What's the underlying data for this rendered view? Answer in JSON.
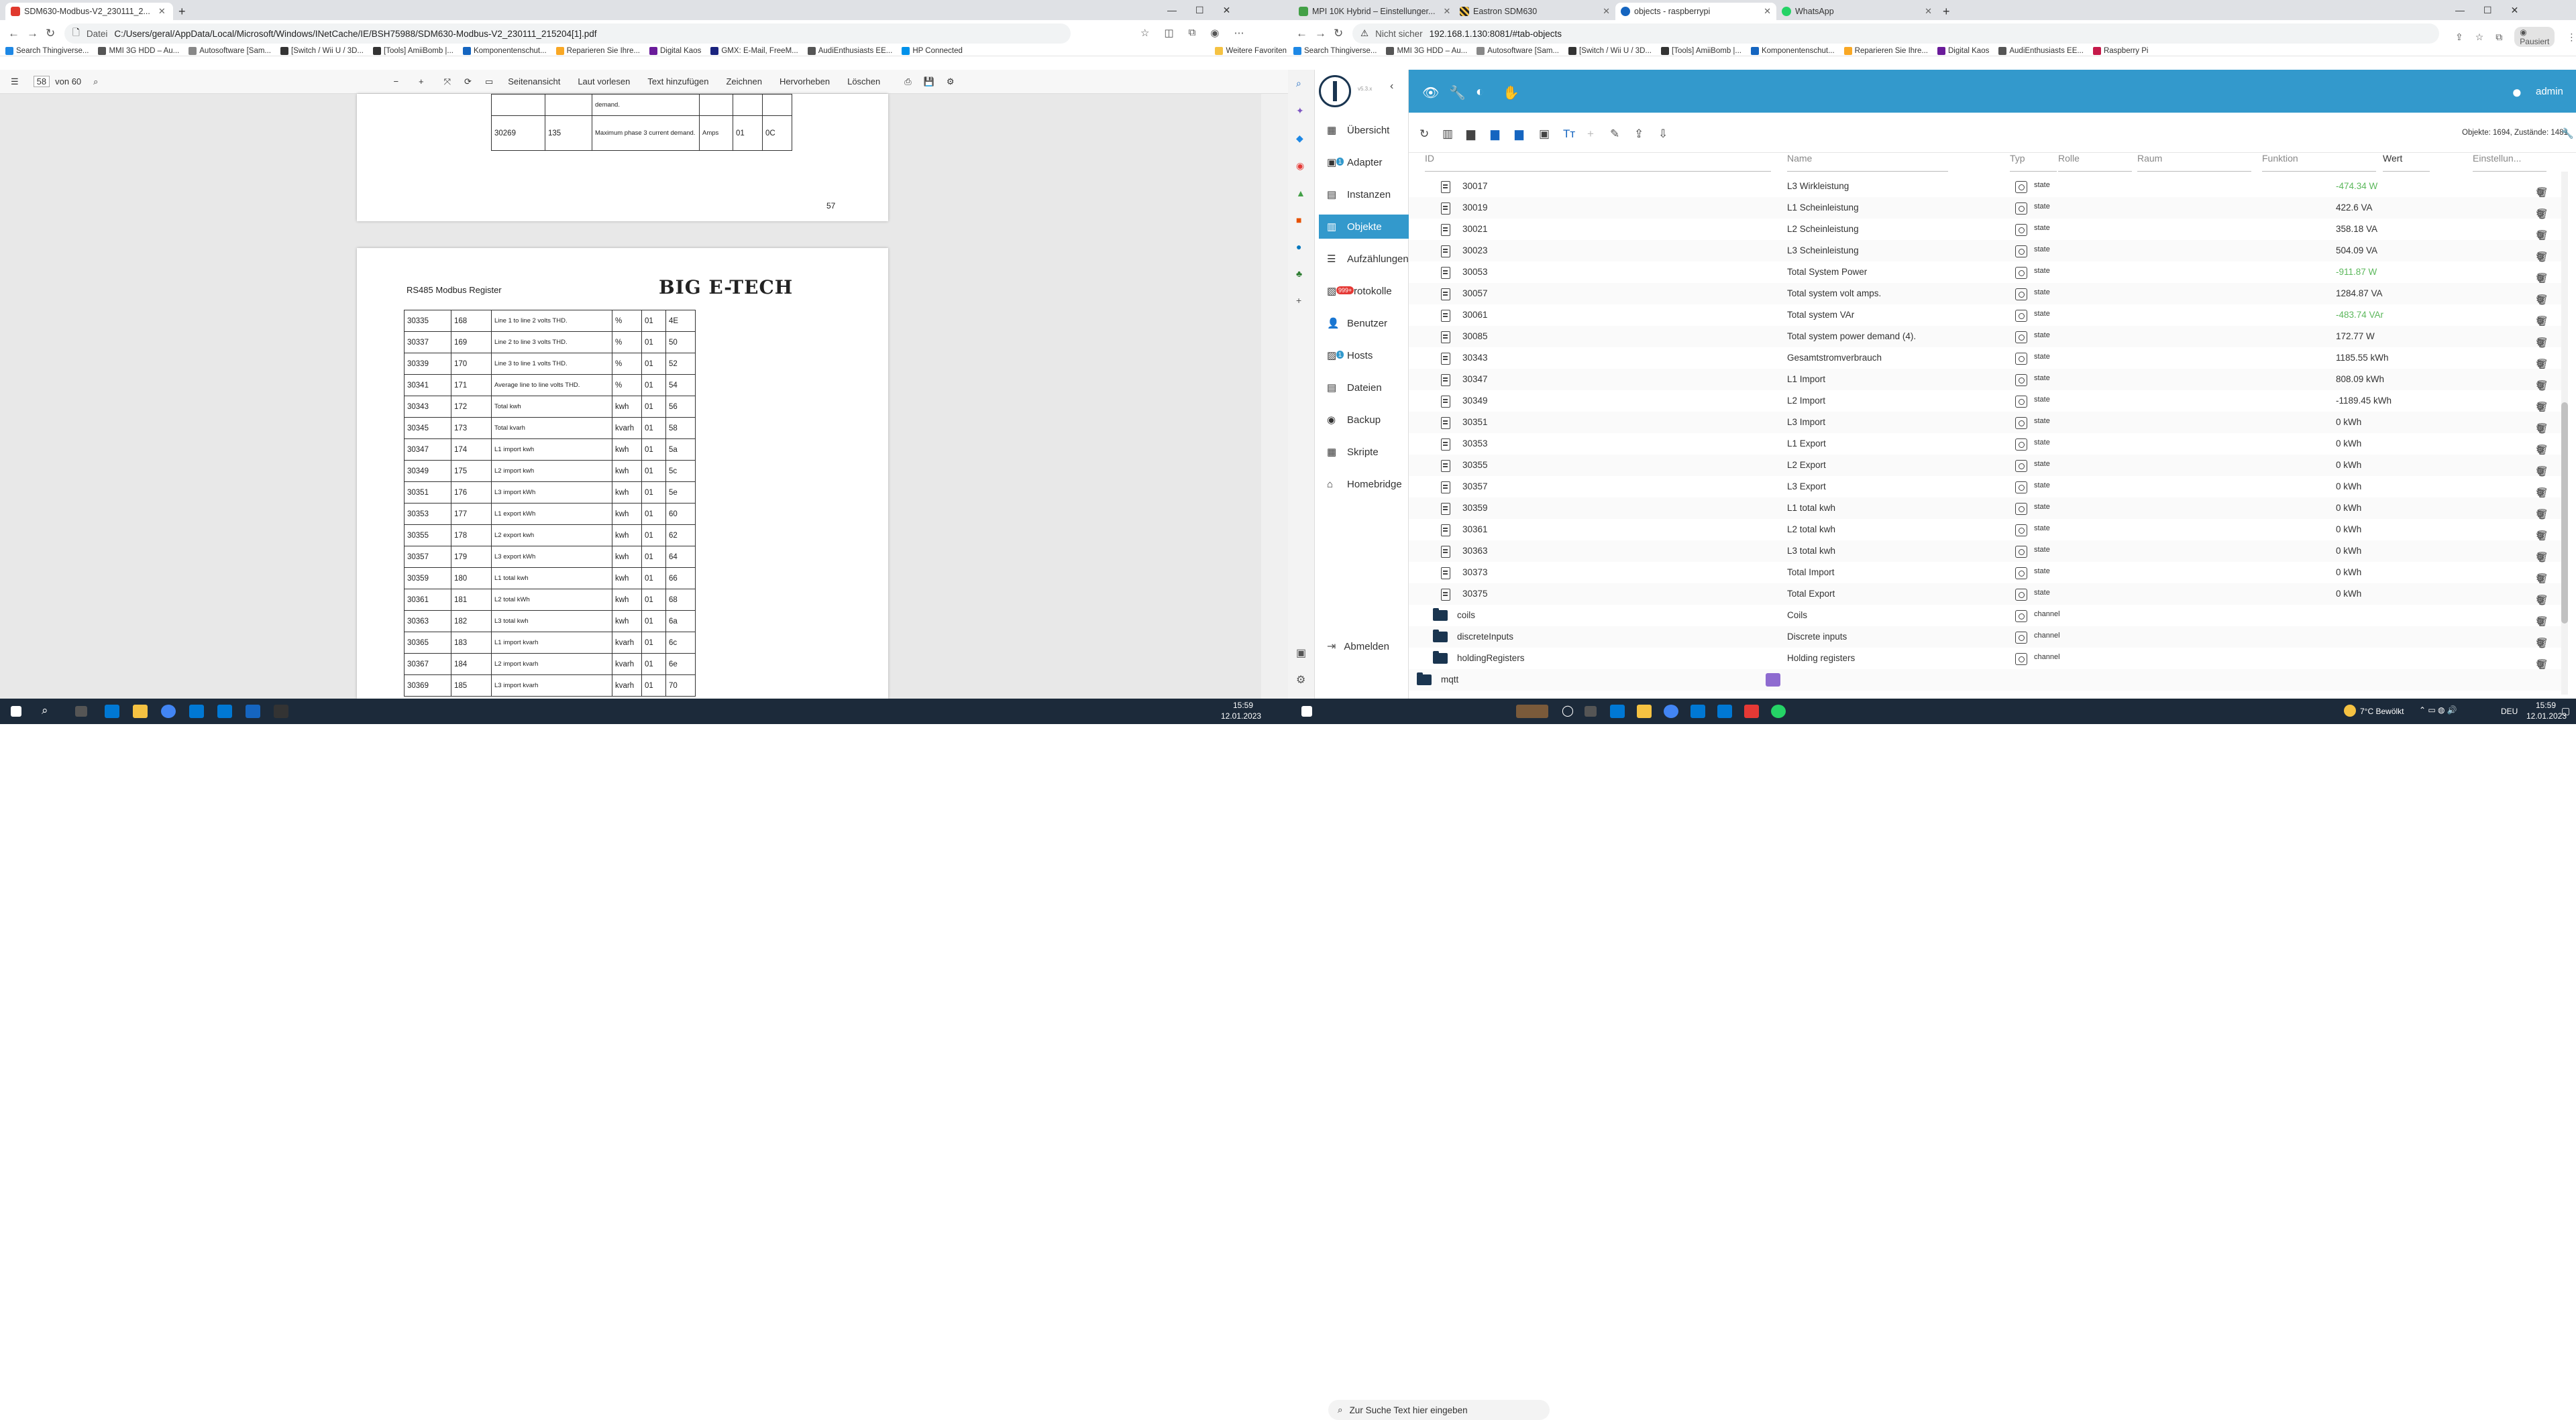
{
  "left_browser": {
    "tabs": [
      {
        "label": "SDM630-Modbus-V2_230111_2..."
      }
    ],
    "address": {
      "label": "Datei",
      "url": "C:/Users/geral/AppData/Local/Microsoft/Windows/INetCache/IE/BSH75988/SDM630-Modbus-V2_230111_215204[1].pdf"
    },
    "bookmarks": [
      "Search Thingiverse...",
      "MMI 3G HDD – Au...",
      "Autosoftware [Sam...",
      "[Switch / Wii U / 3D...",
      "[Tools] AmiiBomb |...",
      "Komponentenschut...",
      "Reparieren Sie Ihre...",
      "Digital Kaos",
      "GMX: E-Mail, FreeM...",
      "AudiEnthusiasts EE...",
      "HP Connected",
      "Weitere Favoriten"
    ],
    "pdf_toolbar": {
      "page_value": "58",
      "page_of": "von 60",
      "items": [
        "Seitenansicht",
        "Laut vorlesen",
        "Text hinzufügen",
        "Zeichnen",
        "Hervorheben",
        "Löschen"
      ]
    },
    "page1": {
      "rows": [
        [
          "",
          "",
          "demand.",
          "",
          "",
          ""
        ],
        [
          "30269",
          "135",
          "Maximum phase 3 current demand.",
          "Amps",
          "01",
          "0C"
        ]
      ],
      "page_number": "57"
    },
    "page2": {
      "heading": "RS485 Modbus Register",
      "logo": "BIG E-TECH",
      "rows": [
        [
          "30335",
          "168",
          "Line 1 to line 2 volts THD.",
          "%",
          "01",
          "4E"
        ],
        [
          "30337",
          "169",
          "Line 2 to line 3 volts THD.",
          "%",
          "01",
          "50"
        ],
        [
          "30339",
          "170",
          "Line 3 to line 1 volts THD.",
          "%",
          "01",
          "52"
        ],
        [
          "30341",
          "171",
          "Average line to line volts THD.",
          "%",
          "01",
          "54"
        ],
        [
          "30343",
          "172",
          "Total kwh",
          "kwh",
          "01",
          "56"
        ],
        [
          "30345",
          "173",
          "Total kvarh",
          "kvarh",
          "01",
          "58"
        ],
        [
          "30347",
          "174",
          "L1 import kwh",
          "kwh",
          "01",
          "5a"
        ],
        [
          "30349",
          "175",
          "L2 import kwh",
          "kwh",
          "01",
          "5c"
        ],
        [
          "30351",
          "176",
          "L3 import kWh",
          "kwh",
          "01",
          "5e"
        ],
        [
          "30353",
          "177",
          "L1 export kWh",
          "kwh",
          "01",
          "60"
        ],
        [
          "30355",
          "178",
          "L2 export kwh",
          "kwh",
          "01",
          "62"
        ],
        [
          "30357",
          "179",
          "L3 export kWh",
          "kwh",
          "01",
          "64"
        ],
        [
          "30359",
          "180",
          "L1 total kwh",
          "kwh",
          "01",
          "66"
        ],
        [
          "30361",
          "181",
          "L2 total kWh",
          "kwh",
          "01",
          "68"
        ],
        [
          "30363",
          "182",
          "L3 total kwh",
          "kwh",
          "01",
          "6a"
        ],
        [
          "30365",
          "183",
          "L1 import kvarh",
          "kvarh",
          "01",
          "6c"
        ],
        [
          "30367",
          "184",
          "L2 import kvarh",
          "kvarh",
          "01",
          "6e"
        ],
        [
          "30369",
          "185",
          "L3 import kvarh",
          "kvarh",
          "01",
          "70"
        ]
      ]
    }
  },
  "right_browser": {
    "tabs": [
      {
        "label": "MPI 10K Hybrid – Einstellunger..."
      },
      {
        "label": "Eastron SDM630"
      },
      {
        "label": "objects - raspberrypi"
      },
      {
        "label": "WhatsApp"
      }
    ],
    "address": {
      "label": "Nicht sicher",
      "url": "192.168.1.130:8081/#tab-objects"
    },
    "bookmarks": [
      "Search Thingiverse...",
      "MMI 3G HDD – Au...",
      "Autosoftware [Sam...",
      "[Switch / Wii U / 3D...",
      "[Tools] AmiiBomb |...",
      "Komponentenschut...",
      "Reparieren Sie Ihre...",
      "Digital Kaos",
      "AudiEnthusiasts EE...",
      "Raspberry Pi"
    ],
    "user": "admin",
    "menu": [
      {
        "label": "Übersicht",
        "badge": ""
      },
      {
        "label": "Adapter",
        "badge": "1"
      },
      {
        "label": "Instanzen",
        "badge": ""
      },
      {
        "label": "Objekte",
        "badge": ""
      },
      {
        "label": "Aufzählungen",
        "badge": ""
      },
      {
        "label": "Protokolle",
        "badge": "999+"
      },
      {
        "label": "Benutzer",
        "badge": ""
      },
      {
        "label": "Hosts",
        "badge": "1"
      },
      {
        "label": "Dateien",
        "badge": ""
      },
      {
        "label": "Backup",
        "badge": ""
      },
      {
        "label": "Skripte",
        "badge": ""
      },
      {
        "label": "Homebridge",
        "badge": ""
      }
    ],
    "logout": "Abmelden",
    "version": "v5.3.x",
    "objects_count": "Objekte: 1694, Zustände: 1481",
    "columns": {
      "id": "ID",
      "name": "Name",
      "type": "Typ",
      "role": "Rolle",
      "room": "Raum",
      "function": "Funktion",
      "value": "Wert",
      "settings": "Einstellun..."
    },
    "rows": [
      {
        "id": "30017",
        "name": "L3 Wirkleistung",
        "type": "state",
        "value": "-474.34 W",
        "color": "#5cb85c"
      },
      {
        "id": "30019",
        "name": "L1 Scheinleistung",
        "type": "state",
        "value": "422.6 VA",
        "color": "#333333"
      },
      {
        "id": "30021",
        "name": "L2 Scheinleistung",
        "type": "state",
        "value": "358.18 VA",
        "color": "#333333"
      },
      {
        "id": "30023",
        "name": "L3 Scheinleistung",
        "type": "state",
        "value": "504.09 VA",
        "color": "#333333"
      },
      {
        "id": "30053",
        "name": "Total System Power",
        "type": "state",
        "value": "-911.87 W",
        "color": "#5cb85c"
      },
      {
        "id": "30057",
        "name": "Total system volt amps.",
        "type": "state",
        "value": "1284.87 VA",
        "color": "#333333"
      },
      {
        "id": "30061",
        "name": "Total system VAr",
        "type": "state",
        "value": "-483.74 VAr",
        "color": "#5cb85c"
      },
      {
        "id": "30085",
        "name": "Total system power demand (4).",
        "type": "state",
        "value": "172.77 W",
        "color": "#333333"
      },
      {
        "id": "30343",
        "name": "Gesamtstromverbrauch",
        "type": "state",
        "value": "1185.55 kWh",
        "color": "#333333"
      },
      {
        "id": "30347",
        "name": "L1 Import",
        "type": "state",
        "value": "808.09 kWh",
        "color": "#333333"
      },
      {
        "id": "30349",
        "name": "L2 Import",
        "type": "state",
        "value": "-1189.45 kWh",
        "color": "#333333"
      },
      {
        "id": "30351",
        "name": "L3 Import",
        "type": "state",
        "value": "0 kWh",
        "color": "#333333"
      },
      {
        "id": "30353",
        "name": "L1 Export",
        "type": "state",
        "value": "0 kWh",
        "color": "#333333"
      },
      {
        "id": "30355",
        "name": "L2 Export",
        "type": "state",
        "value": "0 kWh",
        "color": "#333333"
      },
      {
        "id": "30357",
        "name": "L3 Export",
        "type": "state",
        "value": "0 kWh",
        "color": "#333333"
      },
      {
        "id": "30359",
        "name": "L1 total kwh",
        "type": "state",
        "value": "0 kWh",
        "color": "#333333"
      },
      {
        "id": "30361",
        "name": "L2 total kwh",
        "type": "state",
        "value": "0 kWh",
        "color": "#333333"
      },
      {
        "id": "30363",
        "name": "L3 total kwh",
        "type": "state",
        "value": "0 kWh",
        "color": "#333333"
      },
      {
        "id": "30373",
        "name": "Total Import",
        "type": "state",
        "value": "0 kWh",
        "color": "#333333"
      },
      {
        "id": "30375",
        "name": "Total Export",
        "type": "state",
        "value": "0 kWh",
        "color": "#333333"
      }
    ],
    "folders": [
      {
        "id": "coils",
        "name": "Coils",
        "type": "channel"
      },
      {
        "id": "discreteInputs",
        "name": "Discrete inputs",
        "type": "channel"
      },
      {
        "id": "holdingRegisters",
        "name": "Holding registers",
        "type": "channel"
      }
    ],
    "last_folder": "mqtt"
  },
  "taskbar": {
    "search_placeholder": "Zur Suche Text hier eingeben",
    "left_clock": {
      "time": "15:59",
      "date": "12.01.2023"
    },
    "right_clock": {
      "time": "15:59",
      "date": "12.01.2023"
    },
    "weather": "7°C Bewölkt",
    "lang": "DEU"
  },
  "colors": {
    "accent": "#3399cc",
    "taskbar": "#1c2a3a",
    "positive": "#5cb85c"
  }
}
